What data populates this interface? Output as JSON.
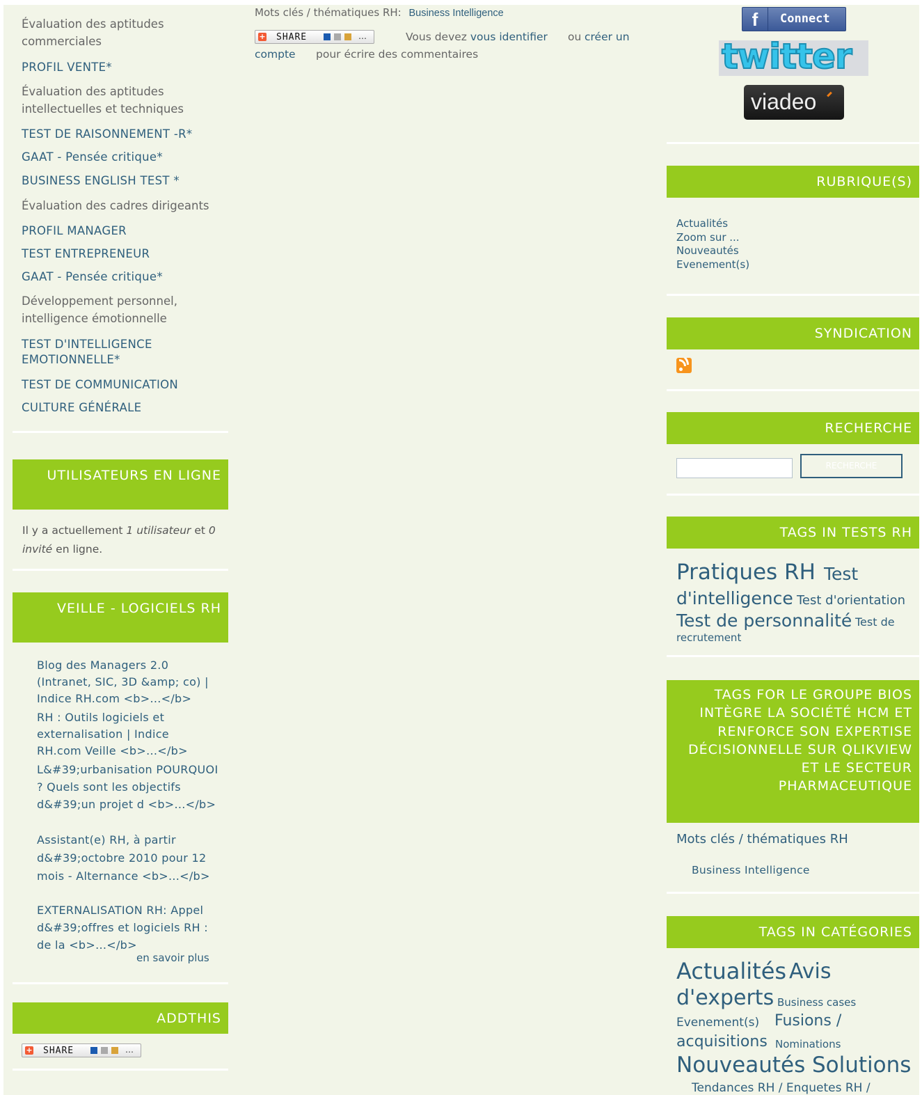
{
  "left": {
    "menu": [
      {
        "type": "cat",
        "text": "Évaluation des aptitudes commerciales"
      },
      {
        "type": "item",
        "text": "PROFIL VENTE*"
      },
      {
        "type": "cat",
        "text": "Évaluation des aptitudes intellectuelles et techniques"
      },
      {
        "type": "item",
        "text": "TEST DE RAISONNEMENT -R*"
      },
      {
        "type": "item",
        "text": "GAAT - Pensée critique*"
      },
      {
        "type": "item",
        "text": "BUSINESS ENGLISH TEST *"
      },
      {
        "type": "cat",
        "text": "Évaluation des cadres dirigeants"
      },
      {
        "type": "item",
        "text": "PROFIL MANAGER"
      },
      {
        "type": "item",
        "text": "TEST ENTREPRENEUR"
      },
      {
        "type": "item",
        "text": "GAAT - Pensée critique*"
      },
      {
        "type": "cat",
        "text": "Développement personnel, intelligence émotionnelle"
      },
      {
        "type": "item",
        "text": "TEST D'INTELLIGENCE EMOTIONNELLE*"
      },
      {
        "type": "item",
        "text": "TEST DE COMMUNICATION"
      },
      {
        "type": "item",
        "text": "CULTURE GÉNÉRALE"
      }
    ],
    "online": {
      "title": "UTILISATEURS EN LIGNE",
      "p1": "Il y a actuellement ",
      "count_users": "1 utilisateur",
      "p2": " et ",
      "count_guests": "0 invité",
      "p3": " en ligne."
    },
    "veille": {
      "title": "VEILLE - LOGICIELS RH",
      "items": [
        "Blog des Managers 2.0 (Intranet, SIC, 3D &amp; co) | Indice RH.com <b>...</b>",
        "RH : Outils logiciels et externalisation | Indice RH.com Veille <b>...</b>",
        "L&#39;urbanisation POURQUOI ? Quels sont les objectifs d&#39;un projet d <b>...</b>",
        "Assistant(e) RH, à partir d&#39;octobre 2010 pour 12 mois - Alternance <b>...</b>",
        "EXTERNALISATION RH: Appel d&#39;offres et logiciels RH : de la <b>...</b>"
      ],
      "more": "en savoir plus"
    },
    "addthis": {
      "title": "ADDTHIS",
      "share": "SHARE"
    }
  },
  "main": {
    "keywords_label": "Mots clés / thématiques RH:",
    "keyword": "Business Intelligence",
    "share": "SHARE",
    "must": "Vous devez ",
    "login": "vous identifier",
    "or": "ou ",
    "create": "créer un compte",
    "post": "pour écrire des commentaires"
  },
  "right": {
    "social": {
      "fb": "Connect",
      "twitter": "twitter",
      "viadeo": "viadeo"
    },
    "rubriques": {
      "title": "RUBRIQUE(S)",
      "items": [
        "Actualités",
        "Zoom sur ...",
        "Nouveautés",
        "Evenement(s)"
      ]
    },
    "syndication": {
      "title": "SYNDICATION"
    },
    "search": {
      "title": "RECHERCHE",
      "button": "RECHERCHE",
      "value": ""
    },
    "tags_tests": {
      "title": "TAGS IN TESTS RH",
      "tags": [
        "Pratiques RH",
        "Test d'intelligence",
        "Test d'orientation",
        "Test de personnalité",
        "Test de recrutement"
      ]
    },
    "tags_for": {
      "title": "TAGS FOR LE GROUPE BIOS INTÈGRE LA SOCIÉTÉ HCM ET RENFORCE SON EXPERTISE DÉCISIONNELLE SUR QLIKVIEW ET LE SECTEUR PHARMACEUTIQUE",
      "label": "Mots clés / thématiques RH",
      "tag": "Business Intelligence"
    },
    "tags_cat": {
      "title": "TAGS IN CATÉGORIES",
      "tags": [
        "Actualités",
        "Avis d'experts",
        "Business cases",
        "Evenement(s)",
        "Fusions / acquisitions",
        "Nominations",
        "Nouveautés",
        "Solutions",
        "Tendances RH / Enquetes RH /"
      ]
    }
  },
  "colors": {
    "accent": "#96cb1e",
    "link": "#2f5f7d",
    "background": "#f2f5e8"
  }
}
